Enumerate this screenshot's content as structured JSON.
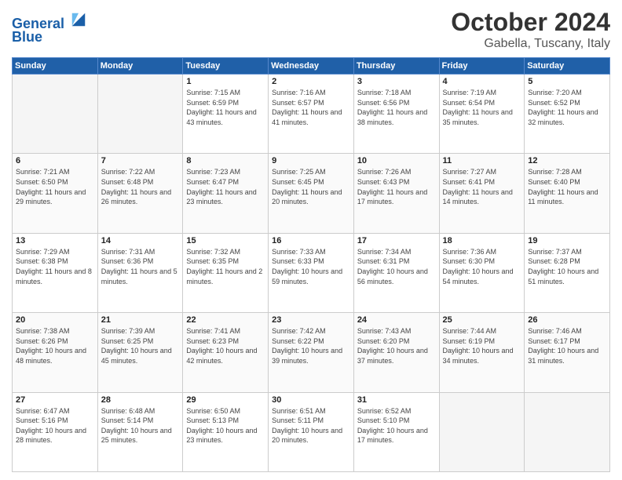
{
  "logo": {
    "line1": "General",
    "line2": "Blue"
  },
  "title": "October 2024",
  "location": "Gabella, Tuscany, Italy",
  "days_of_week": [
    "Sunday",
    "Monday",
    "Tuesday",
    "Wednesday",
    "Thursday",
    "Friday",
    "Saturday"
  ],
  "weeks": [
    [
      {
        "day": "",
        "info": ""
      },
      {
        "day": "",
        "info": ""
      },
      {
        "day": "1",
        "info": "Sunrise: 7:15 AM\nSunset: 6:59 PM\nDaylight: 11 hours and 43 minutes."
      },
      {
        "day": "2",
        "info": "Sunrise: 7:16 AM\nSunset: 6:57 PM\nDaylight: 11 hours and 41 minutes."
      },
      {
        "day": "3",
        "info": "Sunrise: 7:18 AM\nSunset: 6:56 PM\nDaylight: 11 hours and 38 minutes."
      },
      {
        "day": "4",
        "info": "Sunrise: 7:19 AM\nSunset: 6:54 PM\nDaylight: 11 hours and 35 minutes."
      },
      {
        "day": "5",
        "info": "Sunrise: 7:20 AM\nSunset: 6:52 PM\nDaylight: 11 hours and 32 minutes."
      }
    ],
    [
      {
        "day": "6",
        "info": "Sunrise: 7:21 AM\nSunset: 6:50 PM\nDaylight: 11 hours and 29 minutes."
      },
      {
        "day": "7",
        "info": "Sunrise: 7:22 AM\nSunset: 6:48 PM\nDaylight: 11 hours and 26 minutes."
      },
      {
        "day": "8",
        "info": "Sunrise: 7:23 AM\nSunset: 6:47 PM\nDaylight: 11 hours and 23 minutes."
      },
      {
        "day": "9",
        "info": "Sunrise: 7:25 AM\nSunset: 6:45 PM\nDaylight: 11 hours and 20 minutes."
      },
      {
        "day": "10",
        "info": "Sunrise: 7:26 AM\nSunset: 6:43 PM\nDaylight: 11 hours and 17 minutes."
      },
      {
        "day": "11",
        "info": "Sunrise: 7:27 AM\nSunset: 6:41 PM\nDaylight: 11 hours and 14 minutes."
      },
      {
        "day": "12",
        "info": "Sunrise: 7:28 AM\nSunset: 6:40 PM\nDaylight: 11 hours and 11 minutes."
      }
    ],
    [
      {
        "day": "13",
        "info": "Sunrise: 7:29 AM\nSunset: 6:38 PM\nDaylight: 11 hours and 8 minutes."
      },
      {
        "day": "14",
        "info": "Sunrise: 7:31 AM\nSunset: 6:36 PM\nDaylight: 11 hours and 5 minutes."
      },
      {
        "day": "15",
        "info": "Sunrise: 7:32 AM\nSunset: 6:35 PM\nDaylight: 11 hours and 2 minutes."
      },
      {
        "day": "16",
        "info": "Sunrise: 7:33 AM\nSunset: 6:33 PM\nDaylight: 10 hours and 59 minutes."
      },
      {
        "day": "17",
        "info": "Sunrise: 7:34 AM\nSunset: 6:31 PM\nDaylight: 10 hours and 56 minutes."
      },
      {
        "day": "18",
        "info": "Sunrise: 7:36 AM\nSunset: 6:30 PM\nDaylight: 10 hours and 54 minutes."
      },
      {
        "day": "19",
        "info": "Sunrise: 7:37 AM\nSunset: 6:28 PM\nDaylight: 10 hours and 51 minutes."
      }
    ],
    [
      {
        "day": "20",
        "info": "Sunrise: 7:38 AM\nSunset: 6:26 PM\nDaylight: 10 hours and 48 minutes."
      },
      {
        "day": "21",
        "info": "Sunrise: 7:39 AM\nSunset: 6:25 PM\nDaylight: 10 hours and 45 minutes."
      },
      {
        "day": "22",
        "info": "Sunrise: 7:41 AM\nSunset: 6:23 PM\nDaylight: 10 hours and 42 minutes."
      },
      {
        "day": "23",
        "info": "Sunrise: 7:42 AM\nSunset: 6:22 PM\nDaylight: 10 hours and 39 minutes."
      },
      {
        "day": "24",
        "info": "Sunrise: 7:43 AM\nSunset: 6:20 PM\nDaylight: 10 hours and 37 minutes."
      },
      {
        "day": "25",
        "info": "Sunrise: 7:44 AM\nSunset: 6:19 PM\nDaylight: 10 hours and 34 minutes."
      },
      {
        "day": "26",
        "info": "Sunrise: 7:46 AM\nSunset: 6:17 PM\nDaylight: 10 hours and 31 minutes."
      }
    ],
    [
      {
        "day": "27",
        "info": "Sunrise: 6:47 AM\nSunset: 5:16 PM\nDaylight: 10 hours and 28 minutes."
      },
      {
        "day": "28",
        "info": "Sunrise: 6:48 AM\nSunset: 5:14 PM\nDaylight: 10 hours and 25 minutes."
      },
      {
        "day": "29",
        "info": "Sunrise: 6:50 AM\nSunset: 5:13 PM\nDaylight: 10 hours and 23 minutes."
      },
      {
        "day": "30",
        "info": "Sunrise: 6:51 AM\nSunset: 5:11 PM\nDaylight: 10 hours and 20 minutes."
      },
      {
        "day": "31",
        "info": "Sunrise: 6:52 AM\nSunset: 5:10 PM\nDaylight: 10 hours and 17 minutes."
      },
      {
        "day": "",
        "info": ""
      },
      {
        "day": "",
        "info": ""
      }
    ]
  ]
}
